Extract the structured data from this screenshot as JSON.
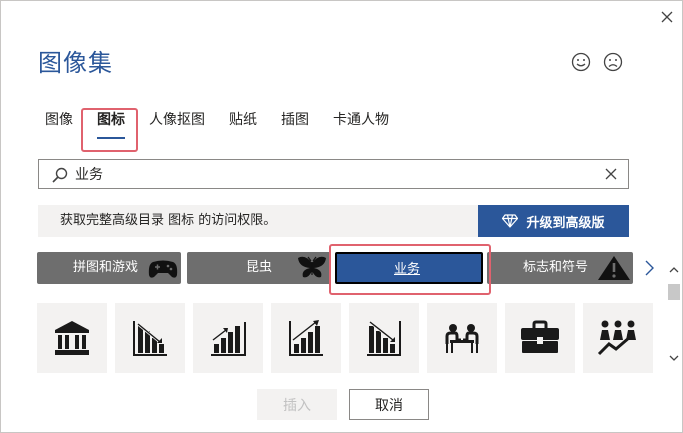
{
  "dialog": {
    "title": "图像集"
  },
  "tabs": [
    {
      "label": "图像"
    },
    {
      "label": "图标",
      "active": true
    },
    {
      "label": "人像抠图"
    },
    {
      "label": "贴纸"
    },
    {
      "label": "插图"
    },
    {
      "label": "卡通人物"
    }
  ],
  "search": {
    "value": "业务"
  },
  "banner": {
    "text": "获取完整高级目录 图标 的访问权限。",
    "upgrade_label": "升级到高级版"
  },
  "categories": [
    {
      "label": "拼图和游戏",
      "icon": "gamepad-icon"
    },
    {
      "label": "昆虫",
      "icon": "butterfly-icon"
    },
    {
      "label": "业务",
      "selected": true
    },
    {
      "label": "标志和符号",
      "icon": "warning-sign-icon"
    }
  ],
  "icons": [
    "bank-icon",
    "declining-chart-icon",
    "bar-chart-icon",
    "rising-chart-icon",
    "down-chart-icon",
    "meeting-icon",
    "briefcase-icon",
    "team-growth-icon"
  ],
  "buttons": {
    "insert": "插入",
    "cancel": "取消"
  },
  "colors": {
    "accent": "#2b579a",
    "highlight": "#e0626e",
    "category_bg": "#6e6e6e",
    "tile_bg": "#f3f2f1"
  }
}
